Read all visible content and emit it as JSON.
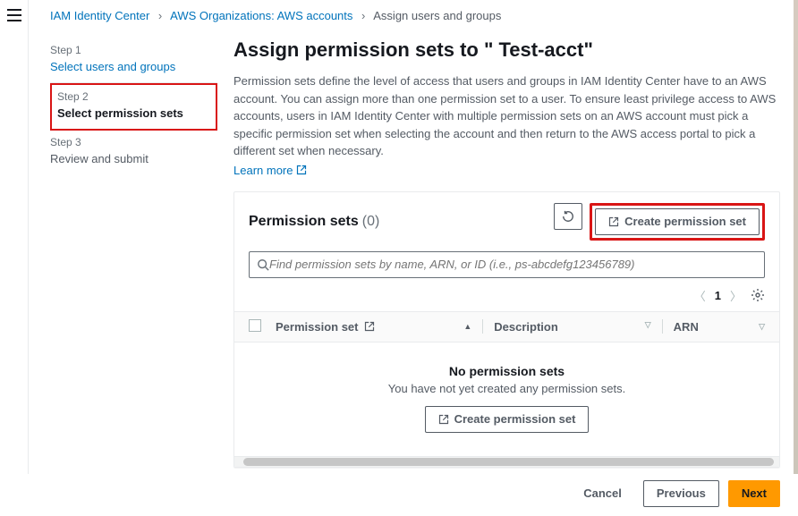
{
  "breadcrumb": {
    "root": "IAM Identity Center",
    "org": "AWS Organizations: AWS accounts",
    "current": "Assign users and groups"
  },
  "steps": {
    "s1": {
      "label": "Step 1",
      "title": "Select users and groups"
    },
    "s2": {
      "label": "Step 2",
      "title": "Select permission sets"
    },
    "s3": {
      "label": "Step 3",
      "title": "Review and submit"
    }
  },
  "page": {
    "title": "Assign permission sets to \" Test-acct\"",
    "intro": "Permission sets define the level of access that users and groups in IAM Identity Center have to an AWS account. You can assign more than one permission set to a user. To ensure least privilege access to AWS accounts, users in IAM Identity Center with multiple permission sets on an AWS account must pick a specific permission set when selecting the account and then return to the AWS access portal to pick a different set when necessary.",
    "learn_more": "Learn more"
  },
  "card": {
    "title": "Permission sets",
    "count": "(0)",
    "create_btn": "Create permission set"
  },
  "search": {
    "placeholder": "Find permission sets by name, ARN, or ID (i.e., ps-abcdefg123456789)"
  },
  "pager": {
    "page": "1"
  },
  "columns": {
    "name": "Permission set",
    "desc": "Description",
    "arn": "ARN"
  },
  "empty": {
    "title": "No permission sets",
    "body": "You have not yet created any permission sets.",
    "btn": "Create permission set"
  },
  "footer": {
    "cancel": "Cancel",
    "previous": "Previous",
    "next": "Next"
  }
}
